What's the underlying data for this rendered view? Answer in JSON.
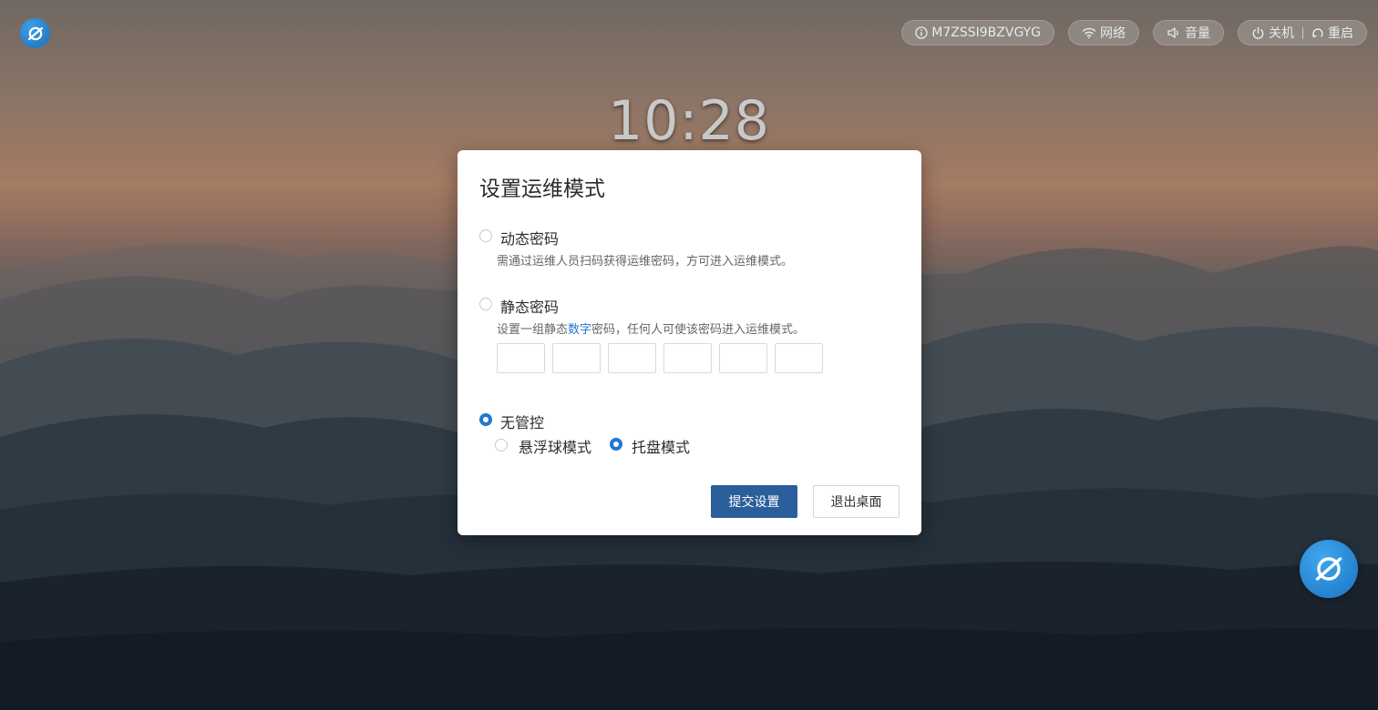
{
  "topbar": {
    "device_id": "M7ZSSI9BZVGYG",
    "network": "网络",
    "volume": "音量",
    "shutdown": "关机",
    "restart": "重启"
  },
  "clock": "10:28",
  "dialog": {
    "title": "设置运维模式",
    "options": [
      {
        "label": "动态密码",
        "description": "需通过运维人员扫码获得运维密码，方可进入运维模式。",
        "selected": false
      },
      {
        "label": "静态密码",
        "description_before": "设置一组静态",
        "description_highlight": "数字",
        "description_after": "密码，任何人可使该密码进入运维模式。",
        "pin_length": 6,
        "selected": false
      },
      {
        "label": "无管控",
        "selected": true,
        "sub_options": [
          {
            "label": "悬浮球模式",
            "selected": false
          },
          {
            "label": "托盘模式",
            "selected": true
          }
        ]
      }
    ],
    "submit_label": "提交设置",
    "exit_label": "退出桌面"
  },
  "colors": {
    "accent": "#1f78d1",
    "primary_button": "#2a5f9b"
  }
}
